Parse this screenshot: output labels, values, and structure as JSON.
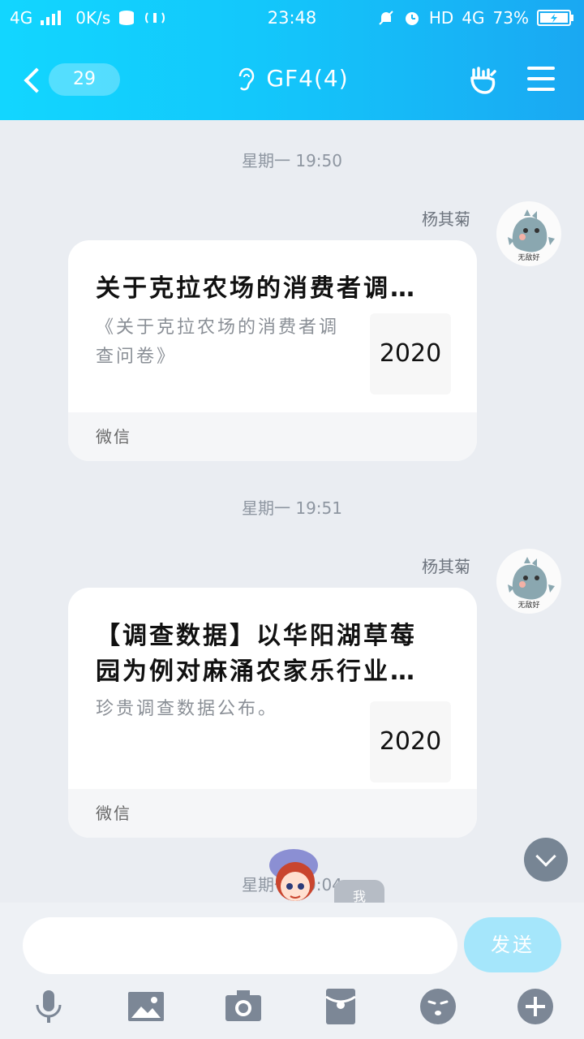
{
  "status": {
    "network": "4G",
    "speed": "0K/s",
    "time": "23:48",
    "hd": "HD",
    "net_type": "4G",
    "battery": "73%"
  },
  "titlebar": {
    "unread_count": "29",
    "chat_title": "GF4(4)"
  },
  "messages": [
    {
      "time": "星期一 19:50",
      "sender": "杨其菊",
      "avatar_caption": "无敌好",
      "card": {
        "title": "关于克拉农场的消费者调…",
        "desc": "《关于克拉农场的消费者调查问卷》",
        "thumb": "2020",
        "source": "微信"
      }
    },
    {
      "time": "星期一 19:51",
      "sender": "杨其菊",
      "avatar_caption": "无敌好",
      "card": {
        "title": "【调查数据】以华阳湖草莓园为例对麻涌农家乐行业…",
        "desc": "珍贵调查数据公布。",
        "thumb": "2020",
        "source": "微信"
      }
    }
  ],
  "partial_time": "星期一 20:04",
  "me_tag": "我",
  "input": {
    "placeholder": "",
    "send_label": "发送"
  },
  "colors": {
    "header_start": "#12d6ff",
    "header_end": "#1aa8f2",
    "send_button": "#a5e6fb",
    "background": "#eaedf2"
  },
  "toolbar": [
    "mic-icon",
    "image-icon",
    "camera-icon",
    "red-packet-icon",
    "emoji-icon",
    "plus-icon"
  ]
}
